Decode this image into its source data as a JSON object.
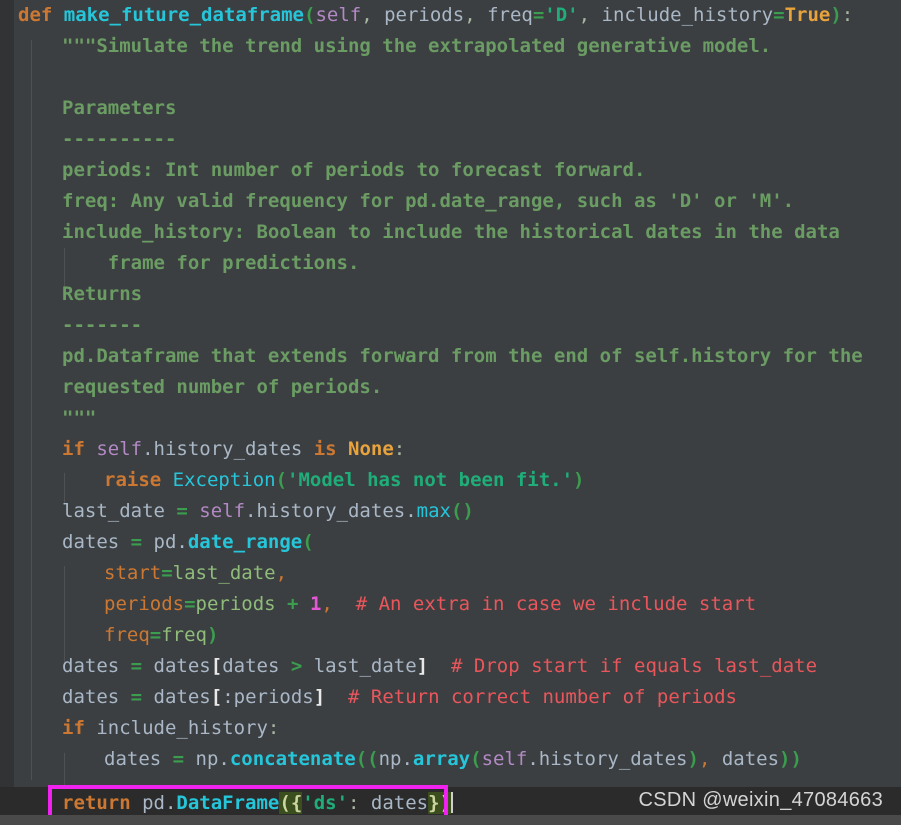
{
  "editor": {
    "language": "python",
    "theme": "darcula-dark",
    "background_color": "#3c3f41",
    "highlight_box_color": "#ef22ef",
    "bracket_match_color": "#3b4f1e"
  },
  "code": {
    "line_01": {
      "kw_def": "def",
      "fn_name": "make_future_dataframe",
      "paren_open": "(",
      "arg_self": "self",
      "comma1": ", ",
      "arg_periods": "periods",
      "comma2": ", ",
      "arg_freq": "freq",
      "eq1": "=",
      "str_d": "'D'",
      "comma3": ", ",
      "arg_include": "include_history",
      "eq2": "=",
      "val_true": "True",
      "paren_close": ")",
      "colon": ":"
    },
    "line_02": "\"\"\"Simulate the trend using the extrapolated generative model.",
    "line_03": "",
    "line_04": "Parameters",
    "line_05": "----------",
    "line_06": "periods: Int number of periods to forecast forward.",
    "line_07": "freq: Any valid frequency for pd.date_range, such as 'D' or 'M'.",
    "line_08": "include_history: Boolean to include the historical dates in the data",
    "line_09": "    frame for predictions.",
    "line_10": "Returns",
    "line_11": "-------",
    "line_12": "pd.Dataframe that extends forward from the end of self.history for the",
    "line_13": "requested number of periods.",
    "line_14": "\"\"\"",
    "line_15": {
      "kw_if": "if",
      "self": "self",
      "dot_attr": ".history_dates ",
      "kw_is": "is",
      "kw_none": " None",
      "colon": ":"
    },
    "line_16": {
      "kw_raise": "raise",
      "exc_name": " Exception",
      "paren_open": "(",
      "string": "'Model has not been fit.'",
      "paren_close": ")"
    },
    "line_17": {
      "var": "last_date ",
      "eq": "= ",
      "self": "self",
      "attr": ".history_dates.",
      "method": "max",
      "parens": "()"
    },
    "line_18": {
      "var": "dates ",
      "eq": "= ",
      "mod": "pd.",
      "method": "date_range",
      "paren_open": "("
    },
    "line_19": {
      "kwarg": "start",
      "eq": "=",
      "val": "last_date",
      "comma": ","
    },
    "line_20": {
      "kwarg": "periods",
      "eq": "=",
      "val": "periods ",
      "plus": "+",
      "num": " 1",
      "comma": ",",
      "comment": "  # An extra in case we include start"
    },
    "line_21": {
      "kwarg": "freq",
      "eq": "=",
      "val": "freq",
      "paren_close": ")"
    },
    "line_22": {
      "var": "dates ",
      "eq": "= ",
      "val": "dates",
      "br_open": "[",
      "inner": "dates ",
      "gt": ">",
      "inner2": " last_date",
      "br_close": "]",
      "comment": "  # Drop start if equals last_date"
    },
    "line_23": {
      "var": "dates ",
      "eq": "= ",
      "val": "dates",
      "br_open": "[",
      "inner": ":periods",
      "br_close": "]",
      "comment": "  # Return correct number of periods"
    },
    "line_24": {
      "kw_if": "if",
      "cond": " include_history",
      "colon": ":"
    },
    "line_25": {
      "var": "dates ",
      "eq": "= ",
      "mod": "np.",
      "method": "concatenate",
      "paren1": "((",
      "mod2": "np.",
      "method2": "array",
      "paren2": "(",
      "self": "self",
      "attr": ".history_dates",
      "paren3": ")",
      "comma": ",",
      "arg": " dates",
      "paren4": "))"
    },
    "line_26": {
      "kw_return": "return",
      "mod": " pd.",
      "cls": "DataFrame",
      "paren_open": "(",
      "brace_open": "{",
      "key": "'ds'",
      "colon": ":",
      "val": " dates",
      "brace_close": "}",
      "paren_close": ")"
    }
  },
  "watermark": {
    "text": "CSDN @weixin_47084663"
  }
}
